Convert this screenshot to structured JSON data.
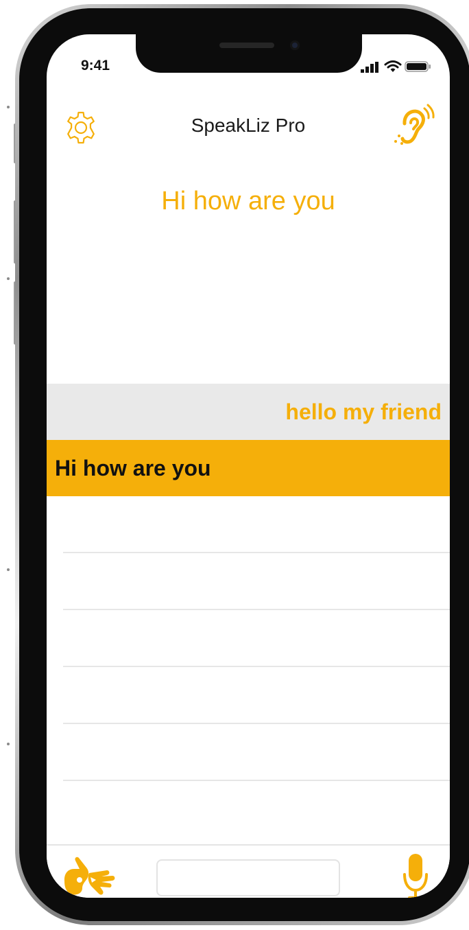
{
  "status_bar": {
    "time": "9:41",
    "signal_icon": "cellular-signal-icon",
    "wifi_icon": "wifi-icon",
    "battery_icon": "battery-icon"
  },
  "header": {
    "title": "SpeakLiz Pro",
    "settings_icon": "gear-icon",
    "hearing_icon": "ear-hearing-icon"
  },
  "transcript": {
    "current_text": "Hi how are you"
  },
  "conversation": {
    "messages": [
      {
        "type": "received",
        "text": "hello my friend"
      },
      {
        "type": "sent",
        "text": "Hi how are you"
      }
    ]
  },
  "bottom_bar": {
    "sign_language_icon": "sign-language-hands-icon",
    "input_value": "",
    "input_placeholder": "",
    "mic_icon": "microphone-icon"
  },
  "colors": {
    "accent": "#F5AF0A",
    "received_bg": "#E9E9E9",
    "text_dark": "#111111"
  }
}
